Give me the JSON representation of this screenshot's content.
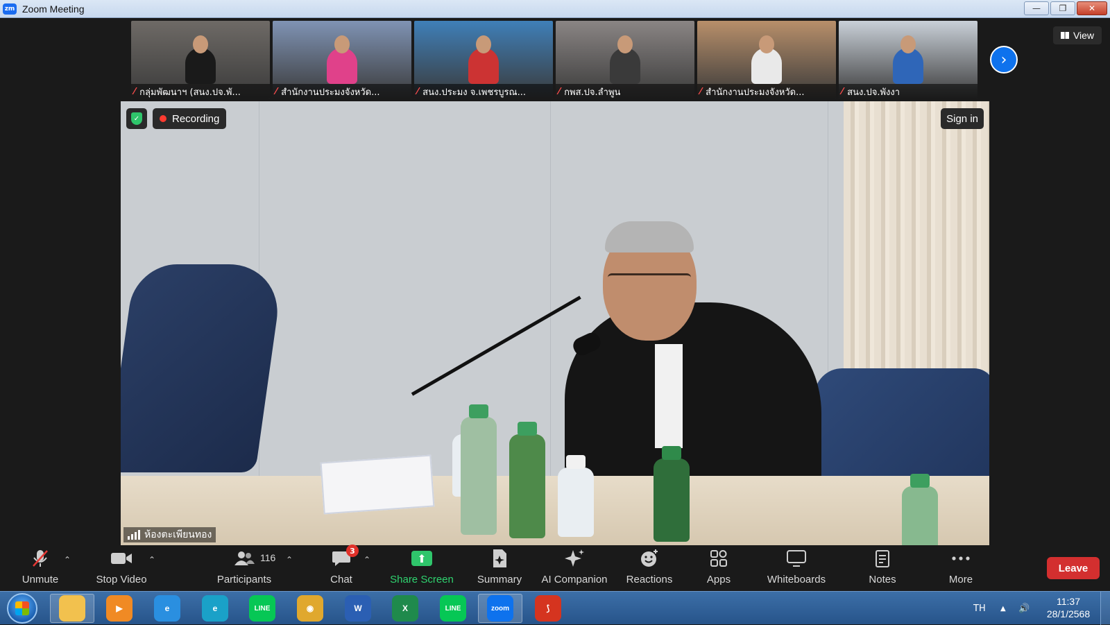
{
  "window": {
    "app_icon_text": "zm",
    "title": "Zoom Meeting",
    "minimize": "—",
    "restore": "❐",
    "close": "✕"
  },
  "thumbnails": [
    {
      "name": "กลุ่มพัฒนาฯ (สนง.ปจ.พั...",
      "scene": "#6e6a66",
      "shirt": "#1a1a1a"
    },
    {
      "name": "สำนักงานประมงจังหวัด...",
      "scene": "#7f93b4",
      "shirt": "#e0418a"
    },
    {
      "name": "สนง.ประมง จ.เพชรบูรณ...",
      "scene": "#3f7fb8",
      "shirt": "#cc3333"
    },
    {
      "name": "กพส.ปจ.ลำพูน",
      "scene": "#8a8584",
      "shirt": "#3a3a3a"
    },
    {
      "name": "สำนักงานประมงจังหวัด...",
      "scene": "#b88f6a",
      "shirt": "#e9e9e9"
    },
    {
      "name": "สนง.ปจ.พังงา",
      "scene": "#c9d0d8",
      "shirt": "#2f66b8"
    }
  ],
  "controls": {
    "view_label": "View",
    "next_icon": "›"
  },
  "main_video": {
    "shield_icon": "✓",
    "recording_label": "Recording",
    "signin_label": "Sign in",
    "room_name": "ห้องตะเพียนทอง"
  },
  "toolbar": {
    "unmute": "Unmute",
    "stop_video": "Stop Video",
    "participants": "Participants",
    "participants_count": "116",
    "chat": "Chat",
    "chat_badge": "3",
    "share_screen": "Share Screen",
    "summary": "Summary",
    "ai_companion": "AI Companion",
    "reactions": "Reactions",
    "apps": "Apps",
    "whiteboards": "Whiteboards",
    "notes": "Notes",
    "more": "More",
    "leave": "Leave",
    "caret": "⌃"
  },
  "taskbar": {
    "apps": [
      {
        "name": "file-explorer",
        "color": "#f2c14e",
        "text": ""
      },
      {
        "name": "media-player",
        "color": "#f08a24",
        "text": "▶"
      },
      {
        "name": "internet-explorer",
        "color": "#2a8fe0",
        "text": "e"
      },
      {
        "name": "edge",
        "color": "#1aa1c8",
        "text": "e"
      },
      {
        "name": "line",
        "color": "#06c755",
        "text": "LINE"
      },
      {
        "name": "chrome",
        "color": "#e0a82e",
        "text": "◉"
      },
      {
        "name": "word",
        "color": "#2b5fb3",
        "text": "W"
      },
      {
        "name": "excel",
        "color": "#1f8a4c",
        "text": "X"
      },
      {
        "name": "line-2",
        "color": "#06c755",
        "text": "LINE"
      },
      {
        "name": "zoom",
        "color": "#0e72ed",
        "text": "zoom"
      },
      {
        "name": "pdf-reader",
        "color": "#d5341f",
        "text": "⟆"
      }
    ],
    "language": "TH",
    "tray_arrow": "▲",
    "volume_icon": "🔊",
    "time": "11:37",
    "date": "28/1/2568"
  }
}
